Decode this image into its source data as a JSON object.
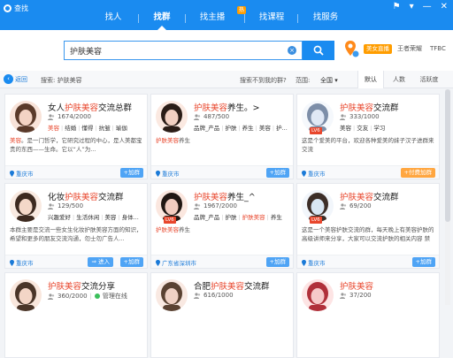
{
  "app": {
    "title": "查找"
  },
  "window": {
    "controls": [
      "⚑",
      "▾",
      "—",
      "✕"
    ]
  },
  "nav": {
    "items": [
      {
        "label": "找人"
      },
      {
        "label": "找群"
      },
      {
        "label": "找主播",
        "badge": "热"
      },
      {
        "label": "找课程"
      },
      {
        "label": "找服务"
      }
    ],
    "active": "找群"
  },
  "search": {
    "value": "护肤美容",
    "clear_icon": "×"
  },
  "search_extras": {
    "badge": "美女直播",
    "link1": "王者荣耀",
    "link2": "TFBC"
  },
  "filter": {
    "back_label": "返回",
    "breadcrumb": "搜索: 护肤美容",
    "not_found": "搜索不到我的群?",
    "range_label": "范围:",
    "range_value": "全国 ▾",
    "sort_tabs": [
      "默认",
      "人数",
      "活跃度"
    ]
  },
  "colors": {
    "brand": "#1a8bf0",
    "highlight": "#e8462c",
    "join": "#4fa4f5",
    "paid": "#ffa640",
    "badge": "#ff9d00"
  },
  "groups": [
    {
      "name_pre": "女人",
      "name_hl": "护肤美容",
      "name_post": "交流总群",
      "members": "1674/2000",
      "rank": "",
      "tags": [
        "美容",
        "结婚",
        "懂得",
        "抗皱",
        "瑜伽"
      ],
      "desc_hl": "美容",
      "desc": "。是一门哲学，它研究过程的中心，是人美都宝贵的东西——生命。它以&ldquo;人&rdquo;为...",
      "city": "重庆市",
      "action": "+加群",
      "action2": ""
    },
    {
      "name_pre": "",
      "name_hl": "护肤美容",
      "name_post": "养生。>",
      "members": "487/500",
      "rank": "",
      "tags": [
        "品牌_产品",
        "护肤",
        "养生",
        "美容",
        "护..."
      ],
      "desc_hl": "护肤美容",
      "desc": "养生",
      "city": "重庆市",
      "action": "+加群",
      "action2": ""
    },
    {
      "name_pre": "",
      "name_hl": "护肤美容",
      "name_post": "交流群",
      "members": "333/1000",
      "rank": "LV6",
      "tags": [
        "美容",
        "交友",
        "学习"
      ],
      "desc_hl": "",
      "desc": "这是个爱美的平台，欢迎各种爱美的妹子汉子进群来交流",
      "city": "重庆市",
      "action": "+付费加群",
      "action2": ""
    },
    {
      "name_pre": "化妆",
      "name_hl": "护肤美容",
      "name_post": "交流群",
      "members": "129/500",
      "rank": "",
      "tags": [
        "兴趣爱好",
        "生活休闲",
        "美容",
        "身体..."
      ],
      "desc_hl": "",
      "desc": "本群主要是交流一些女生化妆护肤美容方面的知识，希望和更多的朋友交流沟通，勿士勿广告人...",
      "city": "重庆市",
      "action": "+加群",
      "action2": "进入"
    },
    {
      "name_pre": "",
      "name_hl": "护肤美容",
      "name_post": "养生_^",
      "members": "1967/2000",
      "rank": "LV6",
      "tags": [
        "品牌_产品",
        "护肤",
        "护肤美容",
        "养生"
      ],
      "desc_hl": "护肤美容",
      "desc": "养生",
      "city": "广东省深圳市",
      "action": "+加群",
      "action2": ""
    },
    {
      "name_pre": "",
      "name_hl": "护肤美容",
      "name_post": "交流群",
      "members": "69/200",
      "rank": "LV6",
      "tags": [],
      "desc_hl": "",
      "desc": "这是一个美容护肤交流的群，每天晚上有美容护肤的高级讲师来分享，大家可以交流护肤的相关内容 禁止...",
      "city": "重庆市",
      "action": "+加群",
      "action2": ""
    },
    {
      "name_pre": "",
      "name_hl": "护肤美容",
      "name_post": "交流分享",
      "members": "360/2000",
      "rank": "",
      "online": "管理在线",
      "tags": [],
      "desc_hl": "",
      "desc": "",
      "city": "",
      "action": "",
      "action2": ""
    },
    {
      "name_pre": "合肥",
      "name_hl": "护肤美容",
      "name_post": "交流群",
      "members": "616/1000",
      "rank": "",
      "tags": [],
      "desc_hl": "",
      "desc": "",
      "city": "",
      "action": "",
      "action2": ""
    },
    {
      "name_pre": "",
      "name_hl": "护肤美容",
      "name_post": "",
      "members": "37/200",
      "rank": "",
      "tags": [],
      "desc_hl": "",
      "desc": "",
      "city": "",
      "action": "",
      "action2": ""
    }
  ]
}
